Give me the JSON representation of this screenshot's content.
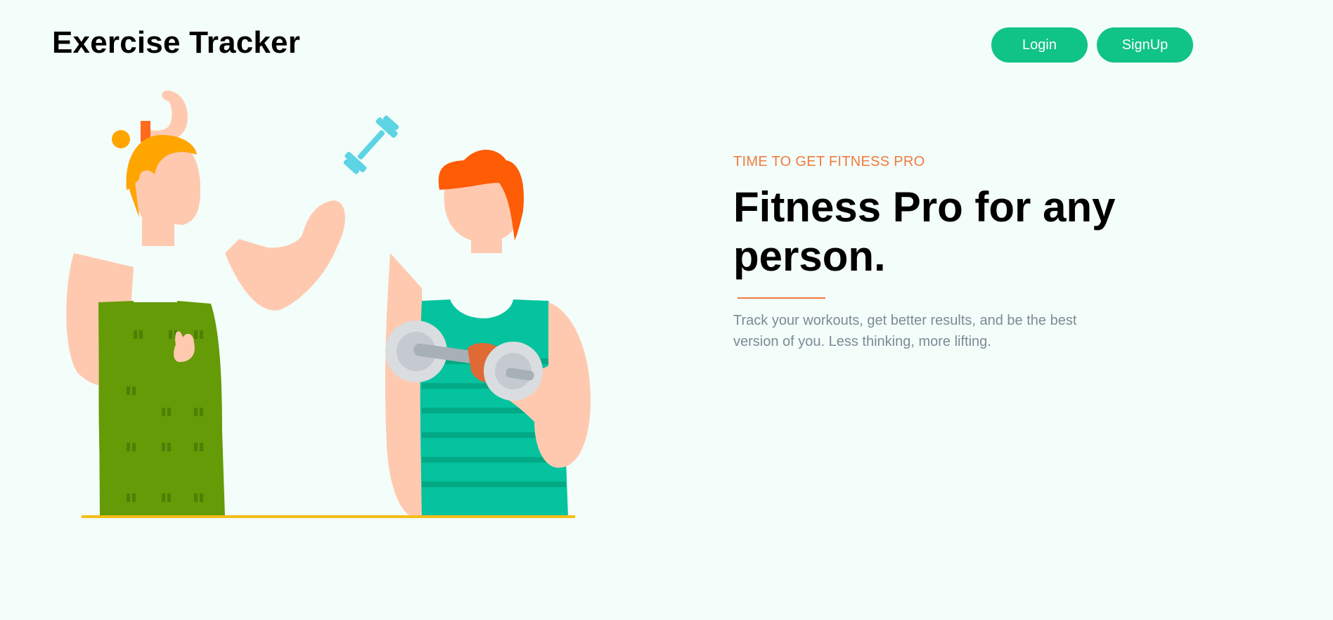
{
  "header": {
    "brand": "Exercise Tracker",
    "login_label": "Login",
    "signup_label": "SignUp"
  },
  "hero": {
    "eyebrow": "TIME TO GET FITNESS PRO",
    "headline": "Fitness Pro for any person.",
    "description": "Track your workouts, get better results, and be the best version of you. Less thinking, more lifting."
  },
  "illustration": {
    "icons": [
      "flexed-bicep-icon",
      "dumbbell-icon"
    ],
    "figures": [
      "man-green-tank-top",
      "man-teal-tank-top-with-dumbbell"
    ]
  },
  "colors": {
    "background": "#f3fdf9",
    "button": "#10c386",
    "accent": "#f07b3f",
    "muted_text": "#7c8a96",
    "floor_line": "#f5bd18"
  }
}
